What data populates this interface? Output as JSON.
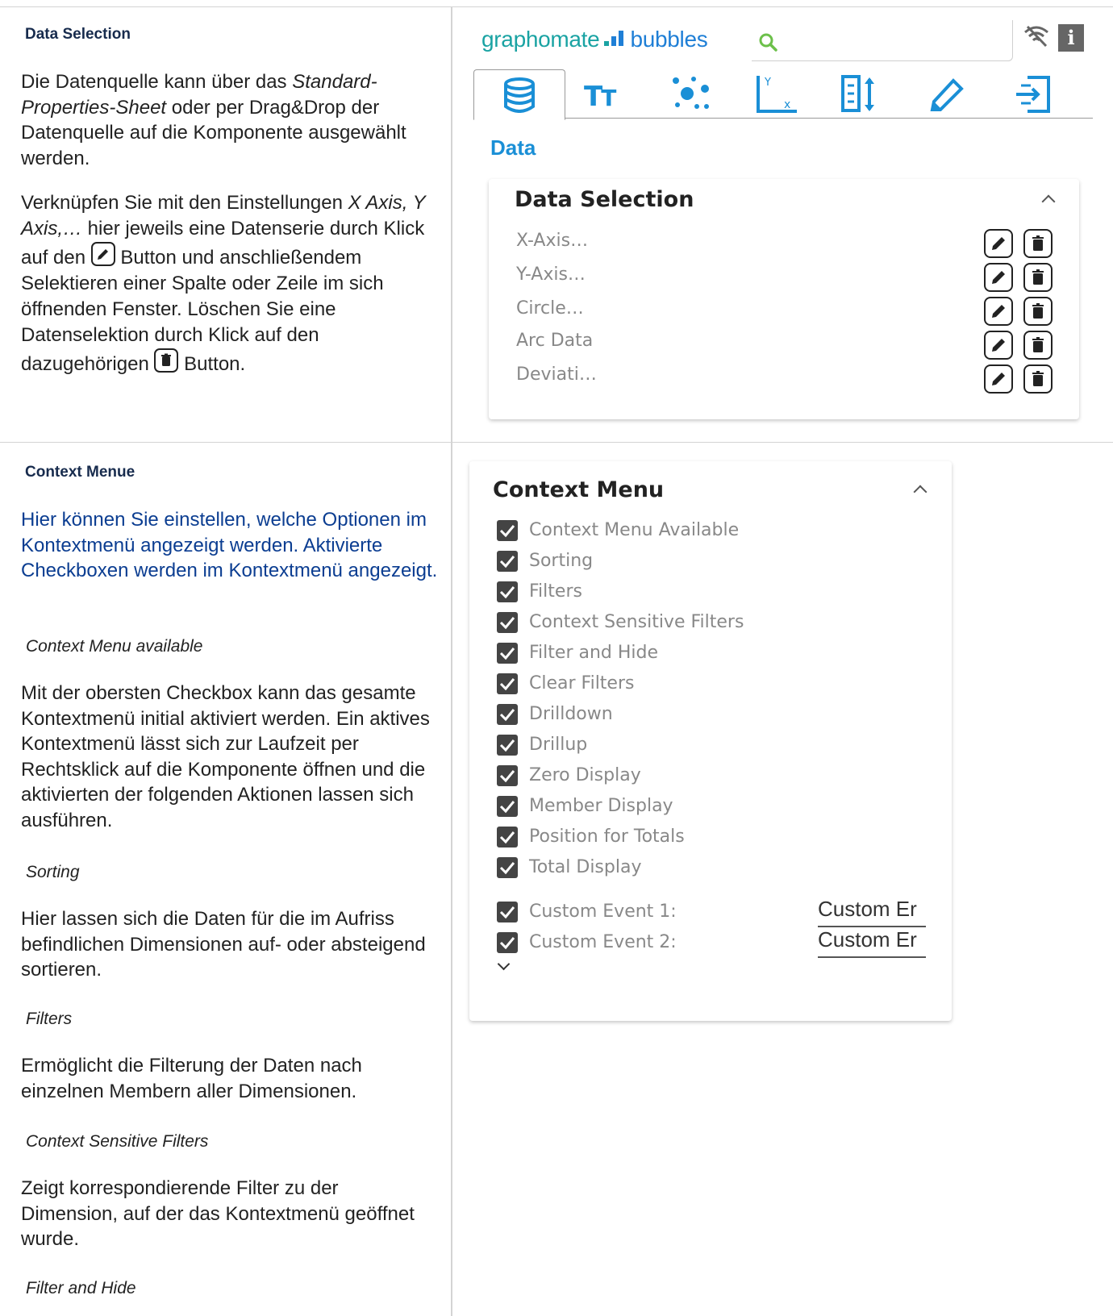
{
  "left": {
    "sections": [
      {
        "title": "Data Selection",
        "paragraphs": {
          "p1": {
            "a": "Die Datenquelle kann über das ",
            "b": "Standard-Properties-Sheet",
            "c": " oder per Drag&Drop der Datenquelle auf die Komponente ausgewählt werden."
          },
          "p2": {
            "a": "Verknüpfen Sie mit den Einstellungen ",
            "b": "X Axis, Y Axis,…",
            "c": " hier jeweils eine Datenserie durch Klick auf den ",
            "d": " Button und anschließendem Selektieren einer Spalte oder Zeile im sich öffnenden Fenster. Löschen Sie eine Datenselektion durch Klick auf den dazugehörigen ",
            "e": " Button."
          }
        }
      },
      {
        "title": "Context Menue",
        "intro": "Hier können Sie einstellen, welche Optionen im Kontextmenü angezeigt werden. Aktivierte Checkboxen werden im Kontextmenü angezeigt.",
        "items": [
          {
            "sub": "Context Menu available",
            "text": "Mit der obersten Checkbox kann das gesamte Kontextmenü initial aktiviert werden. Ein aktives Kontextmenü lässt sich zur Laufzeit per Rechtsklick auf die Komponente öffnen und die aktivierten der folgenden Aktionen lassen sich ausführen."
          },
          {
            "sub": "Sorting",
            "text": "Hier lassen sich die Daten für die im Aufriss befindlichen Dimensionen auf- oder absteigend sortieren."
          },
          {
            "sub": "Filters",
            "text": "Ermöglicht die Filterung der Daten nach einzelnen Membern aller Dimensionen."
          },
          {
            "sub": "Context Sensitive Filters",
            "text": "Zeigt korrespondierende Filter zu der Dimension, auf der das Kontextmenü geöffnet wurde."
          },
          {
            "sub": "Filter and Hide",
            "text": ""
          }
        ]
      }
    ]
  },
  "right": {
    "logo": {
      "part1": "graphomate",
      "part2": "bubbles"
    },
    "search": {
      "placeholder": ""
    },
    "tabs": [
      "data-icon",
      "text-icon",
      "bubbles-icon",
      "axis-icon",
      "layout-icon",
      "pen-icon",
      "export-icon"
    ],
    "data_heading": "Data",
    "data_selection": {
      "title": "Data Selection",
      "rows": [
        "X-Axis…",
        "Y-Axis…",
        "Circle…",
        "Arc Data",
        "Deviati…"
      ]
    },
    "context_menu": {
      "title": "Context Menu",
      "options": [
        "Context Menu Available",
        "Sorting",
        "Filters",
        "Context Sensitive Filters",
        "Filter and Hide",
        "Clear Filters",
        "Drilldown",
        "Drillup",
        "Zero Display",
        "Member Display",
        "Position for Totals",
        "Total Display"
      ],
      "custom_events": [
        {
          "label": "Custom Event 1:",
          "value": "Custom Er"
        },
        {
          "label": "Custom Event 2:",
          "value": "Custom Er"
        }
      ]
    }
  }
}
